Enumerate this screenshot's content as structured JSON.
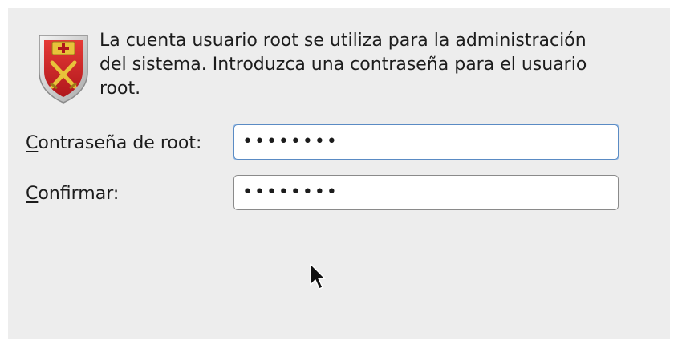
{
  "info": {
    "text": "La cuenta usuario root se utiliza para la administración\ndel sistema. Introduzca una contraseña para el usuario\nroot.",
    "icon": "security-shield-icon"
  },
  "fields": {
    "root_password": {
      "mnemonic": "C",
      "label_rest": "ontraseña de root:",
      "value": "••••••••"
    },
    "confirm": {
      "mnemonic": "C",
      "label_rest": "onfirmar:",
      "value": "••••••••"
    }
  },
  "colors": {
    "panel_background": "#ededed",
    "focus_border": "#5a8bc4",
    "shield_red": "#d9262b",
    "shield_gold": "#e8c23a"
  }
}
